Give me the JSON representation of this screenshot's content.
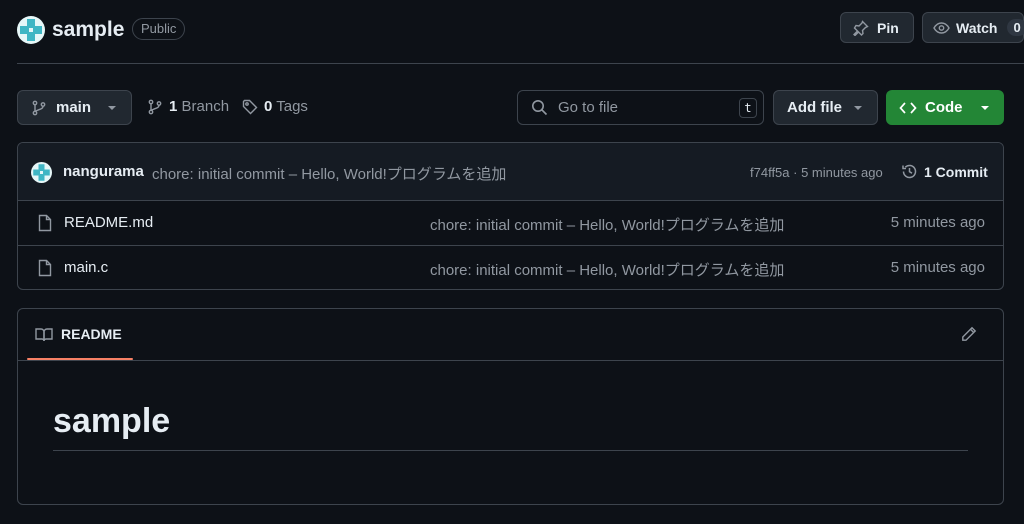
{
  "colors": {
    "background": "#0d1117",
    "border": "#3d444d",
    "button_bg": "#212830",
    "muted_text": "#9198a1",
    "code_button": "#238636",
    "tab_accent": "#f78166"
  },
  "header": {
    "repo_name": "sample",
    "visibility": "Public",
    "pin_label": "Pin",
    "watch_label": "Watch",
    "watch_count": "0"
  },
  "toolbar": {
    "branch": "main",
    "branch_count": "1",
    "branch_label": "Branch",
    "tag_count": "0",
    "tag_label": "Tags",
    "search_placeholder": "Go to file",
    "search_shortcut": "t",
    "add_file_label": "Add file",
    "code_label": "Code"
  },
  "latest_commit": {
    "author": "nangurama",
    "message": "chore: initial commit – Hello, World!プログラムを追加",
    "hash_time": "f74ff5a · 5 minutes ago",
    "commit_count_label": "1 Commit"
  },
  "files": [
    {
      "name": "README.md",
      "commit": "chore: initial commit – Hello, World!プログラムを追加",
      "age": "5 minutes ago"
    },
    {
      "name": "main.c",
      "commit": "chore: initial commit – Hello, World!プログラムを追加",
      "age": "5 minutes ago"
    }
  ],
  "readme": {
    "tab_label": "README",
    "heading": "sample"
  }
}
